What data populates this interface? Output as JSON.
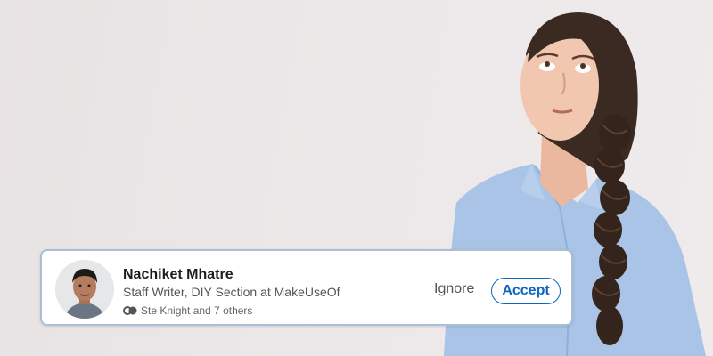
{
  "invitation": {
    "name": "Nachiket Mhatre",
    "headline": "Staff Writer, DIY Section at MakeUseOf",
    "mutual_text": "Ste Knight and 7 others",
    "ignore_label": "Ignore",
    "accept_label": "Accept",
    "accent_color": "#0a66c2",
    "avatar_icon": "profile-photo",
    "mutual_icon": "mutual-connections-icon"
  }
}
